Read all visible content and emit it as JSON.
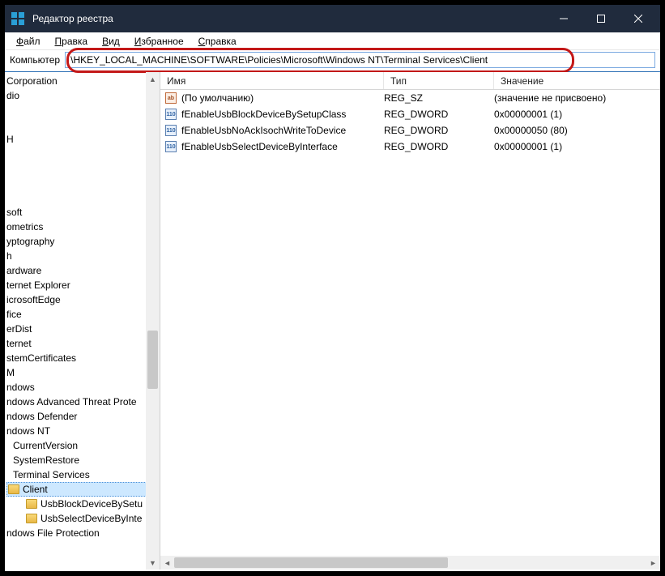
{
  "titlebar": {
    "title": "Редактор реестра"
  },
  "menu": {
    "file": {
      "u": "Ф",
      "rest": "айл"
    },
    "edit": {
      "u": "П",
      "rest": "равка"
    },
    "view": {
      "u": "В",
      "rest": "ид"
    },
    "fav": {
      "u": "И",
      "rest": "збранное"
    },
    "help": {
      "u": "С",
      "rest": "правка"
    }
  },
  "address": {
    "label": "Компьютер",
    "value": "\\HKEY_LOCAL_MACHINE\\SOFTWARE\\Policies\\Microsoft\\Windows NT\\Terminal Services\\Client"
  },
  "tree": [
    {
      "t": "Corporation",
      "indent": 0
    },
    {
      "t": "dio",
      "indent": 0
    },
    {
      "t": "",
      "indent": 0,
      "blank": true
    },
    {
      "t": "",
      "indent": 0,
      "blank": true
    },
    {
      "t": "H",
      "indent": 0
    },
    {
      "t": "",
      "indent": 0,
      "blank": true
    },
    {
      "t": "",
      "indent": 0,
      "blank": true
    },
    {
      "t": "",
      "indent": 0,
      "blank": true
    },
    {
      "t": "",
      "indent": 0,
      "blank": true
    },
    {
      "t": "soft",
      "indent": 0
    },
    {
      "t": "ometrics",
      "indent": 0
    },
    {
      "t": "yptography",
      "indent": 0
    },
    {
      "t": "h",
      "indent": 0
    },
    {
      "t": "ardware",
      "indent": 0
    },
    {
      "t": "ternet Explorer",
      "indent": 0
    },
    {
      "t": "icrosoftEdge",
      "indent": 0
    },
    {
      "t": "fice",
      "indent": 0
    },
    {
      "t": "erDist",
      "indent": 0
    },
    {
      "t": "ternet",
      "indent": 0
    },
    {
      "t": "stemCertificates",
      "indent": 0
    },
    {
      "t": "M",
      "indent": 0
    },
    {
      "t": "ndows",
      "indent": 0
    },
    {
      "t": "ndows Advanced Threat Prote",
      "indent": 0
    },
    {
      "t": "ndows Defender",
      "indent": 0
    },
    {
      "t": "ndows NT",
      "indent": 0
    },
    {
      "t": "CurrentVersion",
      "indent": 1
    },
    {
      "t": "SystemRestore",
      "indent": 1
    },
    {
      "t": "Terminal Services",
      "indent": 1
    },
    {
      "t": "Client",
      "indent": 2,
      "selected": true,
      "folder": true
    },
    {
      "t": "UsbBlockDeviceBySetu",
      "indent": 3,
      "folder": true
    },
    {
      "t": "UsbSelectDeviceByInte",
      "indent": 3,
      "folder": true
    },
    {
      "t": "ndows File Protection",
      "indent": 0,
      "cut": true
    }
  ],
  "columns": {
    "name": "Имя",
    "type": "Тип",
    "value": "Значение"
  },
  "rows": [
    {
      "icon": "sz",
      "name": "(По умолчанию)",
      "type": "REG_SZ",
      "value": "(значение не присвоено)"
    },
    {
      "icon": "dw",
      "name": "fEnableUsbBlockDeviceBySetupClass",
      "type": "REG_DWORD",
      "value": "0x00000001 (1)"
    },
    {
      "icon": "dw",
      "name": "fEnableUsbNoAckIsochWriteToDevice",
      "type": "REG_DWORD",
      "value": "0x00000050 (80)"
    },
    {
      "icon": "dw",
      "name": "fEnableUsbSelectDeviceByInterface",
      "type": "REG_DWORD",
      "value": "0x00000001 (1)"
    }
  ]
}
